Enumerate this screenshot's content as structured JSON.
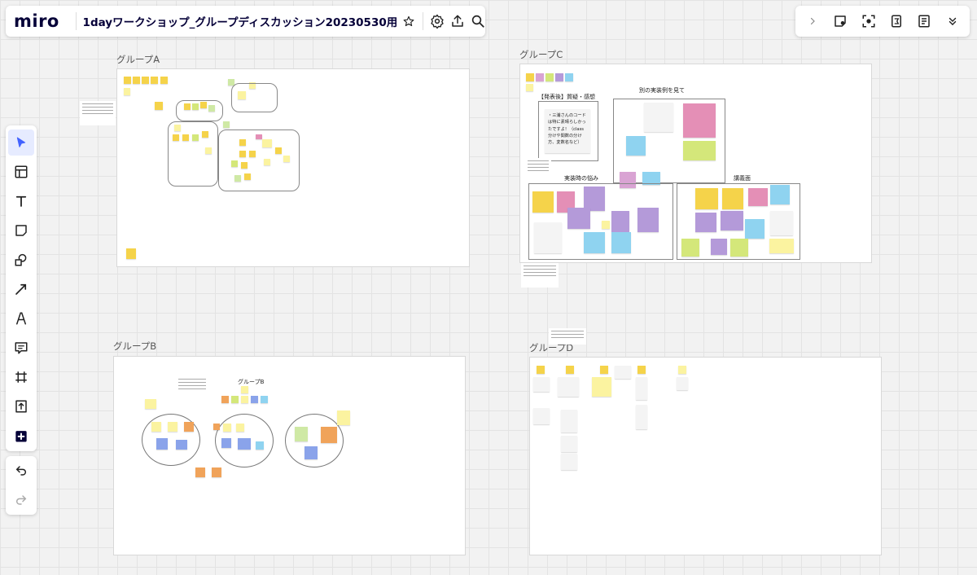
{
  "app": {
    "logo": "miro",
    "board_title": "1dayワークショップ_グループディスカッション20230530用"
  },
  "topbar_icons": [
    "star-icon",
    "settings-icon",
    "export-icon",
    "search-icon"
  ],
  "rightbar_icons": [
    "chevron-right-icon",
    "sticky-note-icon",
    "focus-icon",
    "timer-icon",
    "notes-icon",
    "chevron-double-down-icon"
  ],
  "left_tools": [
    "select-icon",
    "templates-icon",
    "text-icon",
    "sticky-note-icon",
    "shapes-icon",
    "connection-line-icon",
    "pen-icon",
    "comment-icon",
    "frame-icon",
    "upload-icon",
    "more-tools-icon"
  ],
  "history_tools": [
    "undo-icon",
    "redo-icon"
  ],
  "frames": {
    "a": {
      "label": "グループA"
    },
    "b": {
      "label": "グループB"
    },
    "c": {
      "label": "グループC",
      "section_q": "【発表後】質疑・感想",
      "section_alt": "別の実装例を見て",
      "section_trouble": "実装時の悩み",
      "section_lecture": "講義面",
      "note_main": "・三浦さんのコードは特に素晴らしかったですよ！（class分けや関数の分け方、変数名など）"
    },
    "d": {
      "label": "グループD"
    }
  },
  "group_b_label": "グループB",
  "colors": {
    "accent": "#4262ff",
    "logo": "#050038"
  }
}
